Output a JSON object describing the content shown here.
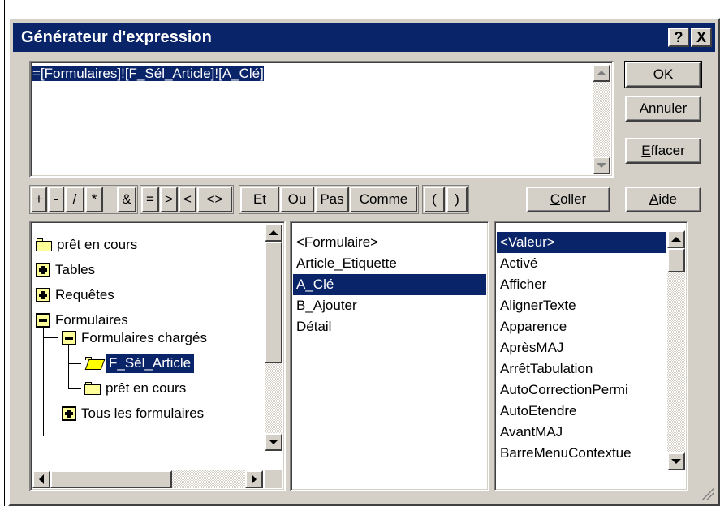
{
  "window": {
    "title": "Générateur d'expression",
    "help_glyph": "?",
    "close_glyph": "X"
  },
  "expression": {
    "value": "=[Formulaires]![F_Sél_Article]![A_Clé]"
  },
  "buttons": {
    "ok": "OK",
    "annuler": "Annuler",
    "effacer_first": "E",
    "effacer_rest": "ffacer",
    "coller_first": "C",
    "coller_rest": "oller",
    "aide_first": "A",
    "aide_rest": "ide"
  },
  "operators": {
    "plus": "+",
    "minus": "-",
    "divide": "/",
    "multiply": "*",
    "concat": "&",
    "equal": "=",
    "greater": ">",
    "less": "<",
    "not_equal": "<>",
    "et": "Et",
    "ou": "Ou",
    "pas": "Pas",
    "comme": "Comme",
    "open_paren": "(",
    "close_paren": ")"
  },
  "tree": {
    "items": [
      {
        "label": "prêt en cours"
      },
      {
        "label": "Tables"
      },
      {
        "label": "Requêtes"
      },
      {
        "label": "Formulaires"
      },
      {
        "label": "Formulaires chargés"
      },
      {
        "label": "F_Sél_Article"
      },
      {
        "label": "prêt en cours"
      },
      {
        "label": "Tous les formulaires"
      }
    ]
  },
  "middle_list": {
    "items": [
      "<Formulaire>",
      "Article_Etiquette",
      "A_Clé",
      "B_Ajouter",
      "Détail"
    ],
    "selected_index": 2
  },
  "right_list": {
    "items": [
      "<Valeur>",
      "Activé",
      "Afficher",
      "AlignerTexte",
      "Apparence",
      "AprèsMAJ",
      "ArrêtTabulation",
      "AutoCorrectionPermi",
      "AutoEtendre",
      "AvantMAJ",
      "BarreMenuContextue"
    ],
    "selected_index": 0
  },
  "colors": {
    "titlebar": "#0a246a",
    "face": "#d4d0c8",
    "selection": "#0a246a"
  }
}
